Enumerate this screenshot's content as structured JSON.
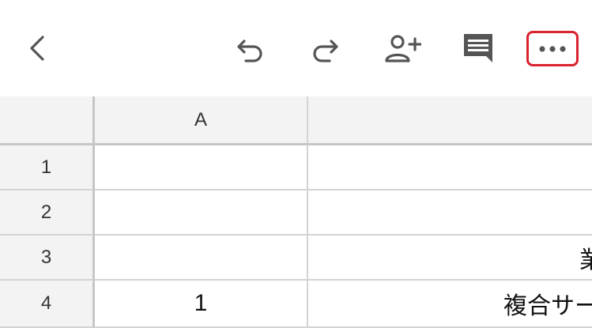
{
  "toolbar": {
    "buttons": [
      {
        "name": "back",
        "icon": "chevron-left-icon"
      },
      {
        "name": "undo",
        "icon": "undo-icon"
      },
      {
        "name": "redo",
        "icon": "redo-icon"
      },
      {
        "name": "share",
        "icon": "add-person-icon"
      },
      {
        "name": "comments",
        "icon": "comment-icon"
      },
      {
        "name": "more",
        "icon": "more-horizontal-icon"
      }
    ],
    "highlight_color": "#d9232f"
  },
  "sheet": {
    "columns": [
      "A",
      ""
    ],
    "rows": [
      {
        "header": "1",
        "A": "",
        "B": ""
      },
      {
        "header": "2",
        "A": "",
        "B": ""
      },
      {
        "header": "3",
        "A": "",
        "B": "業"
      },
      {
        "header": "4",
        "A": "1",
        "B": "複合サー"
      }
    ]
  }
}
